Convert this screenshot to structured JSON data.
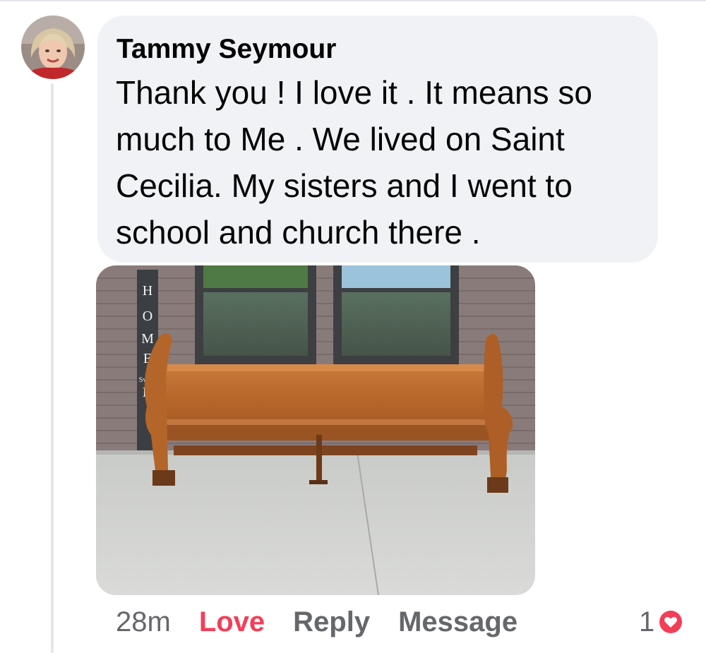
{
  "comment": {
    "author": "Tammy Seymour",
    "text": "Thank you ! I love it . It means so much to Me . We lived on Saint Cecilia. My sisters and I went to school and church there .",
    "photo_sign_letters": [
      "H",
      "O",
      "M",
      "E",
      "Sweet",
      "H"
    ],
    "actions": {
      "time": "28m",
      "love": "Love",
      "reply": "Reply",
      "message": "Message"
    },
    "reactions": {
      "count": "1",
      "icon": "love-reaction-icon"
    }
  },
  "colors": {
    "bubble": "#f0f2f5",
    "love": "#f33e58",
    "meta": "#65676b",
    "text": "#050505"
  }
}
